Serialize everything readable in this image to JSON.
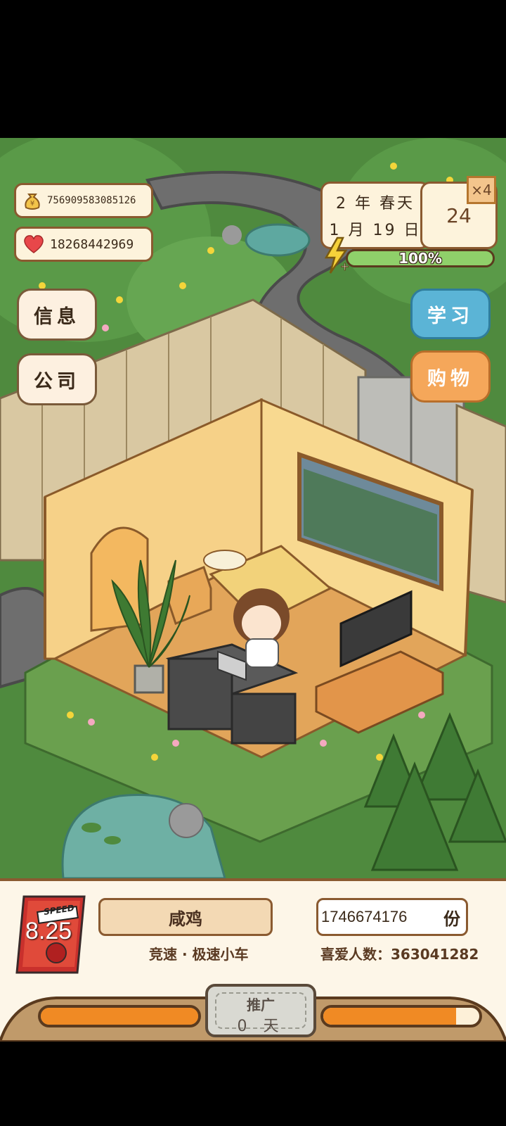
{
  "resources": {
    "money": "756909583085126",
    "hearts": "18268442969"
  },
  "date": {
    "year_season": "2 年 春天",
    "month_day": "1 月 19 日"
  },
  "speed_multiplier": "×4",
  "day_counter": "24",
  "energy": {
    "label": "100%",
    "fraction": 1.0
  },
  "buttons": {
    "info": "信息",
    "company": "公司",
    "study": "学习",
    "shopping": "购物"
  },
  "product": {
    "cover_text": "SPEED",
    "rating": "8.25",
    "name": "咸鸡",
    "genre": "竞速 · 极速小车",
    "score": "1746674176",
    "score_unit": "份",
    "fans": "喜爱人数：363041282"
  },
  "bottom": {
    "promo_label": "推广",
    "promo_days": "0 天",
    "left_progress": 1.0,
    "right_progress": 0.85
  },
  "colors": {
    "panel_border": "#8a5a30",
    "energy_fill": "#8fd06a",
    "bar_fill": "#f08a24",
    "study_button": "#5bb4d6",
    "shopping_button": "#f5a75a"
  }
}
